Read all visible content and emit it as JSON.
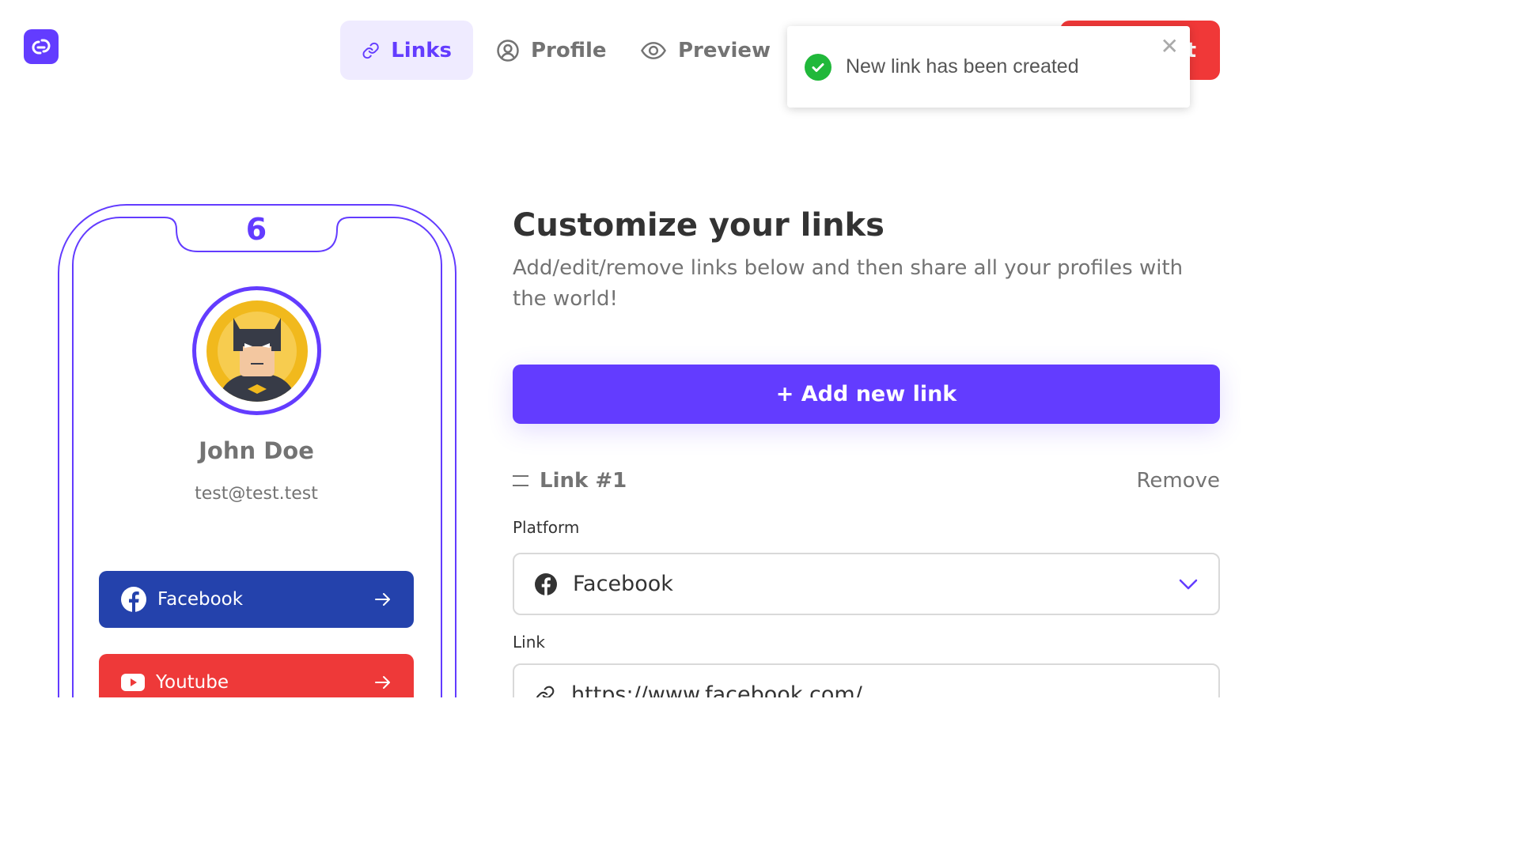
{
  "app": {
    "brand_color": "#633cff"
  },
  "nav": {
    "tabs": [
      {
        "label": "Links",
        "active": true
      },
      {
        "label": "Profile",
        "active": false
      },
      {
        "label": "Preview",
        "active": false
      }
    ],
    "publish_label": "t"
  },
  "toast": {
    "message": "New link has been created",
    "close": "✕"
  },
  "phone": {
    "counter": "6",
    "name": "John Doe",
    "email": "test@test.test",
    "links": [
      {
        "label": "Facebook",
        "color": "#2442ac",
        "icon": "facebook-icon"
      },
      {
        "label": "Youtube",
        "color": "#ee3939",
        "icon": "youtube-icon"
      }
    ]
  },
  "main": {
    "title": "Customize your links",
    "subtitle": "Add/edit/remove links below and then share all your profiles with the world!",
    "add_button": "+ Add new link",
    "link_item": {
      "title": "Link #1",
      "remove": "Remove",
      "platform_label": "Platform",
      "platform_value": "Facebook",
      "link_label": "Link",
      "link_value": "https://www.facebook.com/"
    }
  }
}
